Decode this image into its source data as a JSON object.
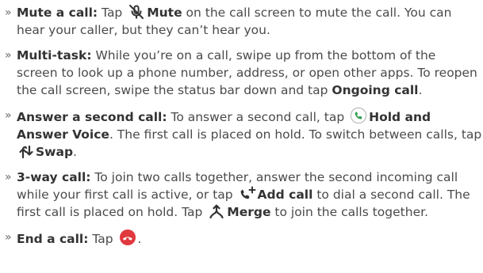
{
  "bullet_glyph": "»",
  "items": [
    {
      "lead": "Mute a call:",
      "t1": " Tap ",
      "kw1": "Mute",
      "t2": " on the call screen to mute the call. You can hear your caller, but they can’t hear you."
    },
    {
      "lead": "Multi-task:",
      "t1": " While you’re on a call, swipe up from the bottom of the screen to look up a phone number, address, or open other apps. To reopen the call screen, swipe the status bar down and tap ",
      "kw1": "Ongoing call",
      "t2": "."
    },
    {
      "lead": "Answer a second call:",
      "t1": " To answer a second call, tap ",
      "kw1": "Hold and Answer Voice",
      "t2": ". The first call is placed on hold. To switch between calls, tap ",
      "kw2": "Swap",
      "t3": "."
    },
    {
      "lead": "3-way call:",
      "t1": " To join two calls together, answer the second incoming call while your first call is active, or tap ",
      "kw1": "Add call",
      "t2": " to dial a second call. The first call is placed on hold. Tap ",
      "kw2": "Merge",
      "t3": " to join the calls together."
    },
    {
      "lead": "End a call:",
      "t1": " Tap ",
      "t2": "."
    }
  ],
  "icons": {
    "mute": "mic-off-icon",
    "answer": "green-phone-icon",
    "swap": "swap-arrows-icon",
    "add_call": "add-call-icon",
    "merge": "merge-arrows-icon",
    "end_call": "red-end-call-icon"
  },
  "colors": {
    "text": "#4a4a4a",
    "bold": "#333333",
    "answer_green": "#2e9e4a",
    "end_red": "#e0393e"
  }
}
